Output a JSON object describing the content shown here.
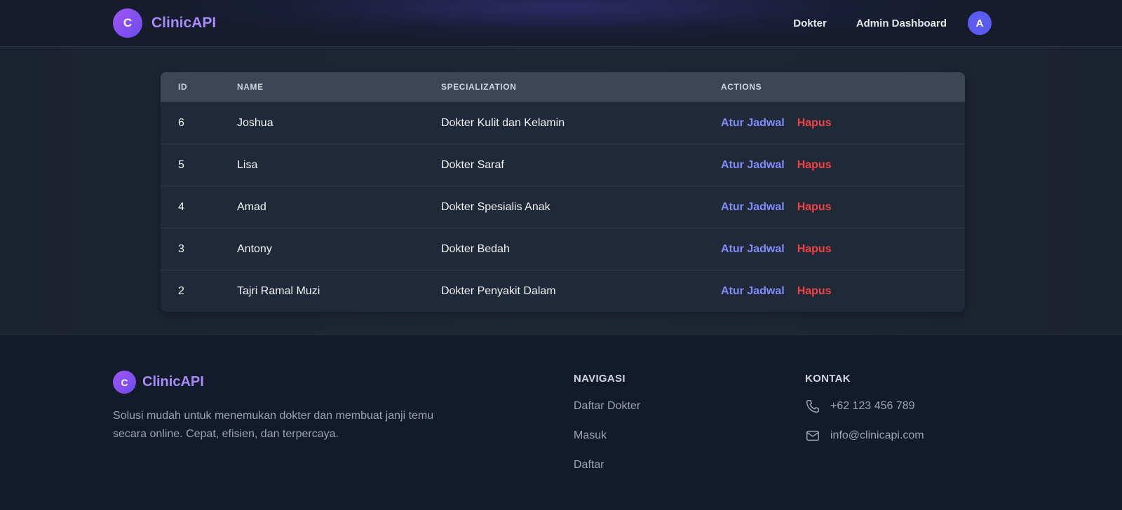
{
  "header": {
    "logo_letter": "C",
    "brand": "ClinicAPI",
    "nav": [
      "Dokter",
      "Admin Dashboard"
    ],
    "avatar_letter": "A"
  },
  "table": {
    "columns": [
      "ID",
      "NAME",
      "SPECIALIZATION",
      "ACTIONS"
    ],
    "rows": [
      {
        "id": "6",
        "name": "Joshua",
        "spec": "Dokter Kulit dan Kelamin"
      },
      {
        "id": "5",
        "name": "Lisa",
        "spec": "Dokter Saraf"
      },
      {
        "id": "4",
        "name": "Amad",
        "spec": "Dokter Spesialis Anak"
      },
      {
        "id": "3",
        "name": "Antony",
        "spec": "Dokter Bedah"
      },
      {
        "id": "2",
        "name": "Tajri Ramal Muzi",
        "spec": "Dokter Penyakit Dalam"
      }
    ],
    "action_schedule": "Atur Jadwal",
    "action_delete": "Hapus"
  },
  "footer": {
    "logo_letter": "C",
    "brand": "ClinicAPI",
    "description": "Solusi mudah untuk menemukan dokter dan membuat janji temu secara online. Cepat, efisien, dan terpercaya.",
    "nav_title": "NAVIGASI",
    "nav_items": [
      "Daftar Dokter",
      "Masuk",
      "Daftar"
    ],
    "contact_title": "KONTAK",
    "phone": "+62 123 456 789",
    "email": "info@clinicapi.com"
  },
  "colors": {
    "accent": "#a78bfa",
    "link": "#818cf8",
    "danger": "#ef4444"
  }
}
